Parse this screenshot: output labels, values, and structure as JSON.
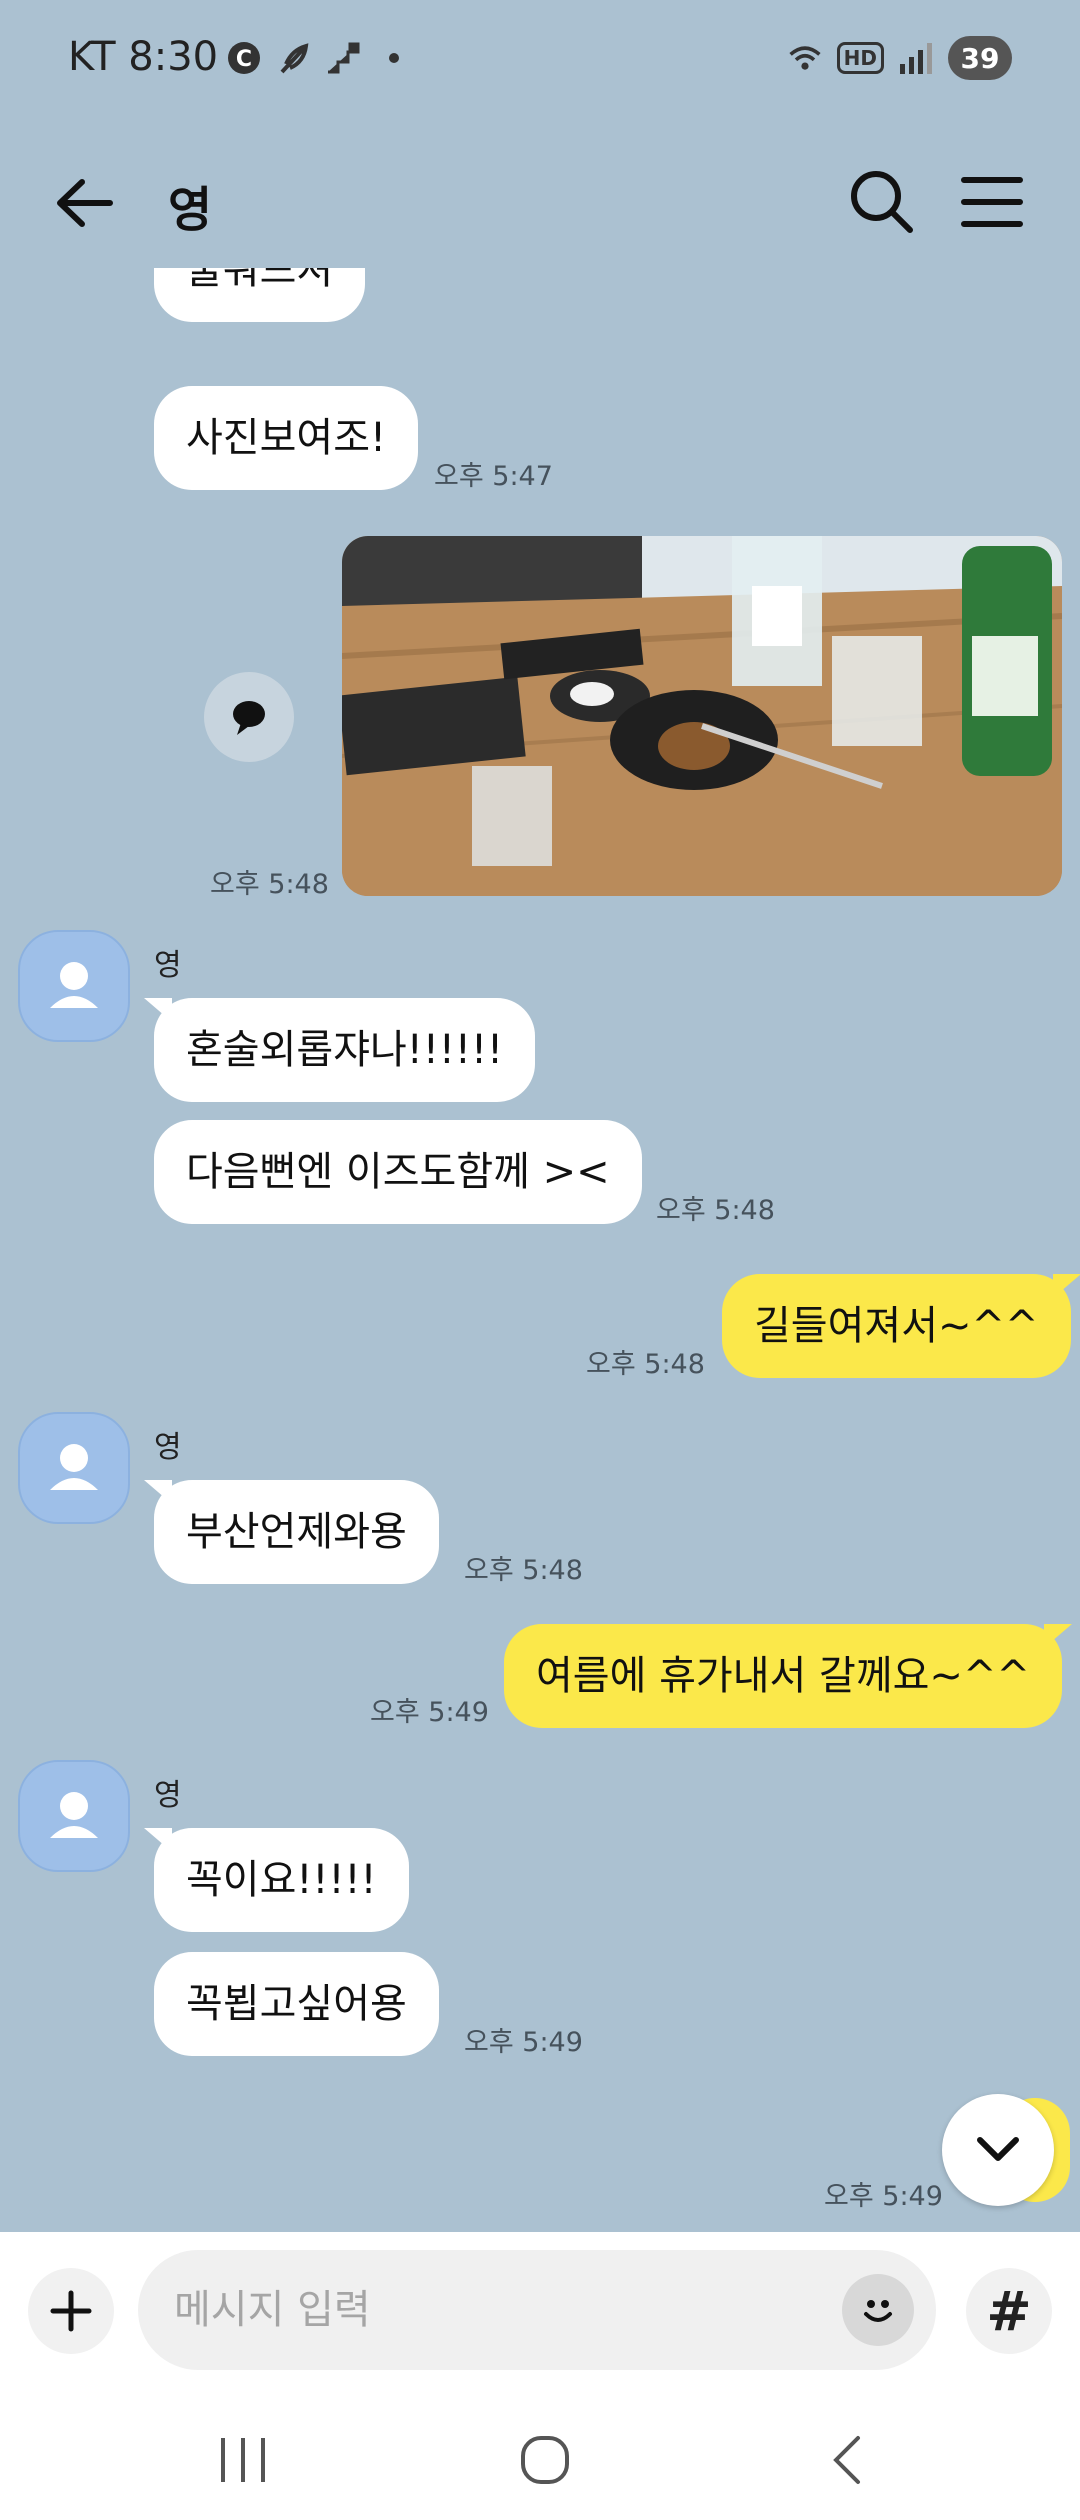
{
  "status_bar": {
    "carrier_time": "KT 8:30",
    "hd": "HD",
    "battery": "39"
  },
  "header": {
    "title": "영"
  },
  "messages": {
    "m1": {
      "text": "술뭐드셔"
    },
    "m2": {
      "text": "사진보여조!",
      "time": "오후 5:47"
    },
    "photo": {
      "time": "오후 5:48"
    },
    "g1": {
      "sender": "영",
      "m1": "혼술외롭쟈나!!!!!!",
      "m2": "다음뻔엔 이즈도함께 ><",
      "time": "오후 5:48"
    },
    "mine1": {
      "text": "길들여져서~^^",
      "time": "오후 5:48"
    },
    "g2": {
      "sender": "영",
      "m1": "부산언제와용",
      "time": "오후 5:48"
    },
    "mine2": {
      "text": "여름에 휴가내서 갈께요~^^",
      "time": "오후 5:49"
    },
    "g3": {
      "sender": "영",
      "m1": "꼭이요!!!!!",
      "m2": "꼭뵙고싶어용",
      "time": "오후 5:49"
    },
    "last": {
      "time": "오후 5:49"
    }
  },
  "input": {
    "placeholder": "메시지 입력",
    "hash": "#"
  },
  "colors": {
    "background": "#abc1d1",
    "my_bubble": "#fbe84a",
    "their_bubble": "#ffffff"
  }
}
